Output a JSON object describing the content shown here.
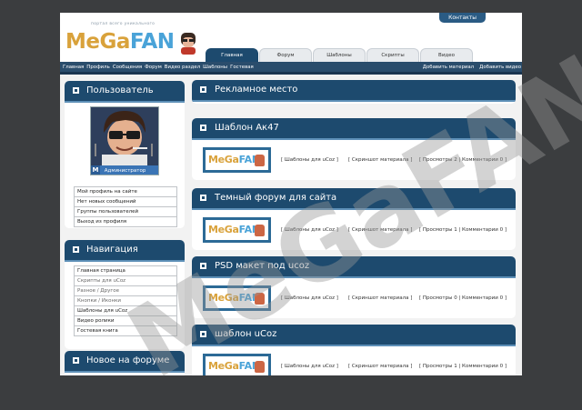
{
  "header": {
    "contacts": "Контакты",
    "slogan": "портал всего уникального",
    "logo_me": "MeGa",
    "logo_fan": "FAN"
  },
  "tabs": [
    "Главная",
    "Форум",
    "Шаблоны",
    "Скрипты",
    "Видео"
  ],
  "navbar": {
    "left": [
      "Главная",
      "Профиль",
      "Сообщения",
      "Форум",
      "Видео раздел",
      "Шаблоны",
      "Гостевая"
    ],
    "right": [
      "Добавить материал",
      "Добавить видео"
    ]
  },
  "user_block": {
    "title": "Пользователь",
    "role_letter": "M",
    "role": "Администратор",
    "menu": [
      "Мой профиль на сайте",
      "Нет новых сообщений",
      "Группы пользователей",
      "Выход из профиля"
    ]
  },
  "nav_block": {
    "title": "Навигация",
    "menu": [
      "Главная страница",
      "Скрипты для uCoz",
      "Разное / Другое",
      "Кнопки / Иконки",
      "Шаблоны для uCoz",
      "Видео ролики",
      "Гостевая книга"
    ]
  },
  "forum_block": {
    "title": "Новое на форуме"
  },
  "ad_block": {
    "title": "Рекламное место"
  },
  "thumb": {
    "me": "MeGa",
    "fan": "FAN"
  },
  "posts": [
    {
      "title": "Шаблон Ак47",
      "category": "[ Шаблоны для uCoz ]",
      "screenshot": "[ Скриншот материала ]",
      "stats": "[ Просмотры 2 | Комментарии 0 ]"
    },
    {
      "title": "Темный форум для сайта",
      "category": "[ Шаблоны для uCoz ]",
      "screenshot": "[ Скриншот материала ]",
      "stats": "[ Просмотры 1 | Комментарии 0 ]"
    },
    {
      "title": "PSD макет под ucoz",
      "category": "[ Шаблоны для uCoz ]",
      "screenshot": "[ Скриншот материала ]",
      "stats": "[ Просмотры 0 | Комментарии 0 ]"
    },
    {
      "title": "шаблон uCoz",
      "category": "[ Шаблоны для uCoz ]",
      "screenshot": "[ Скриншот материала ]",
      "stats": "[ Просмотры 1 | Комментарии 0 ]"
    }
  ],
  "watermark": "MeGaFAN",
  "colors": {
    "header_blue": "#1d4a6e",
    "navbar": "#2a4d6c",
    "accent_orange": "#d9a23b",
    "accent_blue": "#4aa3d8"
  }
}
